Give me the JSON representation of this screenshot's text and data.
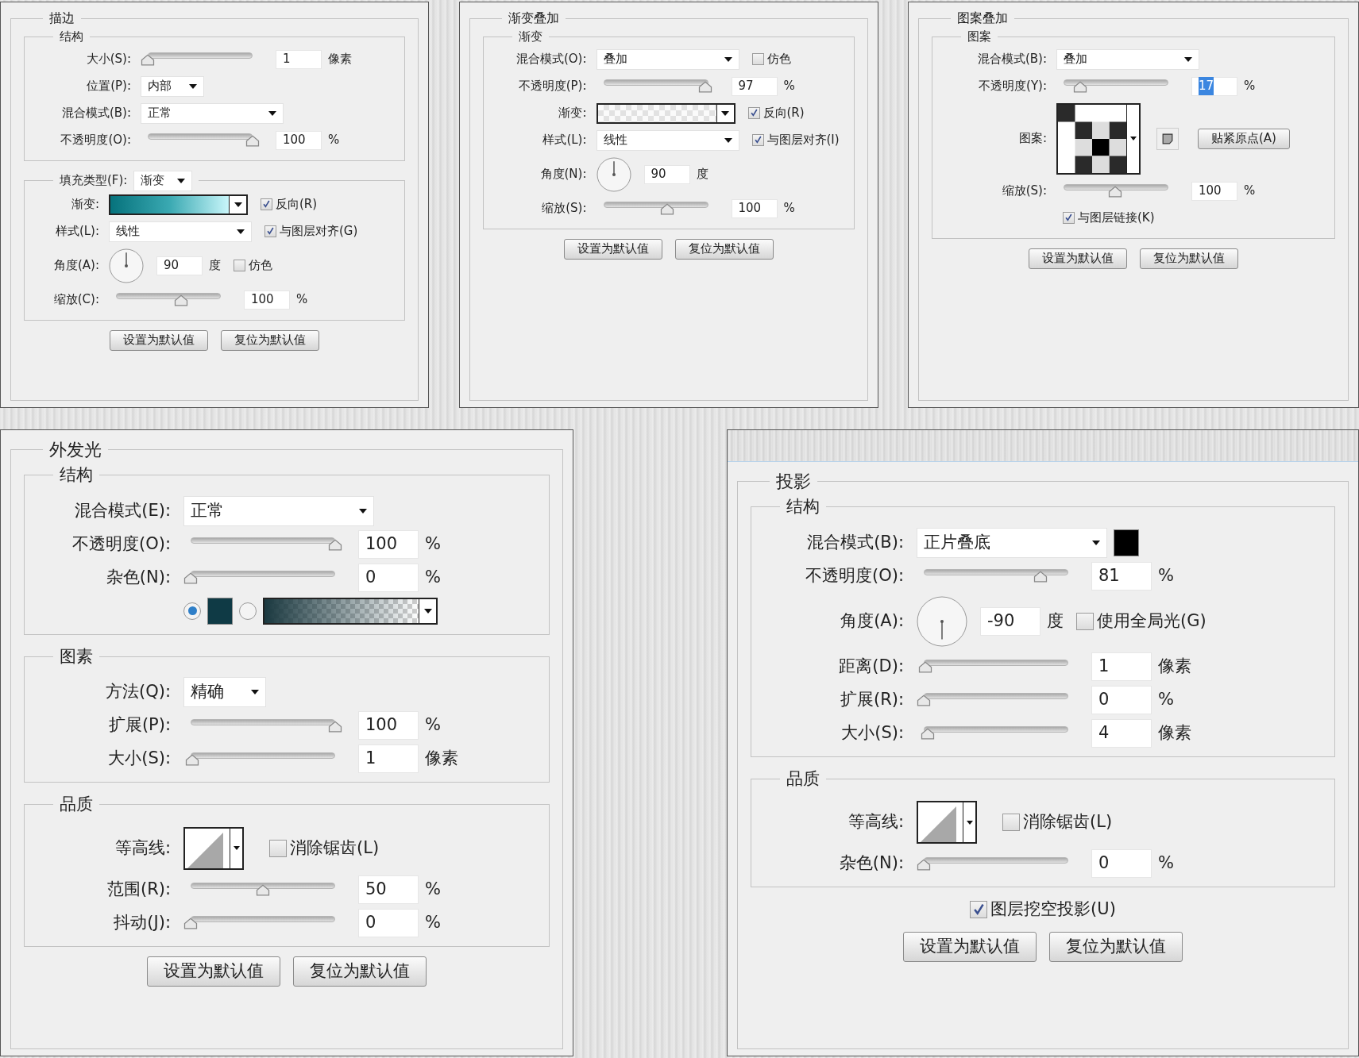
{
  "panels": [
    {
      "title": "描边",
      "groups": [
        {
          "legend": "结构",
          "rows": [
            {
              "label": "大小(S):",
              "items": [
                {
                  "kind": "slider",
                  "level": 0
                },
                {
                  "kind": "input",
                  "value": "1"
                },
                {
                  "kind": "unit",
                  "text": "像素"
                }
              ]
            },
            {
              "label": "位置(P):",
              "items": [
                {
                  "kind": "select",
                  "value": "内部"
                }
              ]
            },
            {
              "label": "混合模式(B):",
              "items": [
                {
                  "kind": "select",
                  "value": "正常"
                }
              ]
            },
            {
              "label": "不透明度(O):",
              "items": [
                {
                  "kind": "slider",
                  "level": 1
                },
                {
                  "kind": "input",
                  "value": "100"
                },
                {
                  "kind": "unit",
                  "text": "%"
                }
              ]
            }
          ]
        },
        {
          "legend": "填充类型(F):",
          "legend_select": "渐变",
          "rows": [
            {
              "label": "渐变:",
              "items": [
                {
                  "kind": "teal_gradient"
                },
                {
                  "kind": "checkbox",
                  "label": "反向(R)",
                  "checked": true
                }
              ]
            },
            {
              "label": "样式(L):",
              "items": [
                {
                  "kind": "select",
                  "value": "线性"
                },
                {
                  "kind": "checkbox",
                  "label": "与图层对齐(G)",
                  "checked": true
                }
              ]
            },
            {
              "label": "角度(A):",
              "items": [
                {
                  "kind": "dial",
                  "pointing_down": false
                },
                {
                  "kind": "input",
                  "value": "90"
                },
                {
                  "kind": "unit",
                  "text": "度"
                },
                {
                  "kind": "checkbox",
                  "label": "仿色",
                  "checked": false
                }
              ]
            },
            {
              "label": "缩放(C):",
              "items": [
                {
                  "kind": "slider",
                  "level": 0.62
                },
                {
                  "kind": "input",
                  "value": "100"
                },
                {
                  "kind": "unit",
                  "text": "%"
                }
              ]
            }
          ]
        }
      ],
      "buttons": [
        "设置为默认值",
        "复位为默认值"
      ]
    },
    {
      "title": "渐变叠加",
      "groups": [
        {
          "legend": "渐变",
          "rows": [
            {
              "label": "混合模式(O):",
              "items": [
                {
                  "kind": "select",
                  "value": "叠加"
                },
                {
                  "kind": "checkbox",
                  "label": "仿色",
                  "checked": false
                }
              ]
            },
            {
              "label": "不透明度(P):",
              "items": [
                {
                  "kind": "slider",
                  "level": 0.97
                },
                {
                  "kind": "input",
                  "value": "97"
                },
                {
                  "kind": "unit",
                  "text": "%"
                }
              ]
            },
            {
              "label": "渐变:",
              "items": [
                {
                  "kind": "checker_gradient"
                },
                {
                  "kind": "checkbox",
                  "label": "反向(R)",
                  "checked": true
                }
              ]
            },
            {
              "label": "样式(L):",
              "items": [
                {
                  "kind": "select",
                  "value": "线性"
                },
                {
                  "kind": "checkbox",
                  "label": "与图层对齐(I)",
                  "checked": true
                }
              ]
            },
            {
              "label": "角度(N):",
              "items": [
                {
                  "kind": "dial",
                  "pointing_down": false
                },
                {
                  "kind": "input",
                  "value": "90"
                },
                {
                  "kind": "unit",
                  "text": "度"
                }
              ]
            },
            {
              "label": "缩放(S):",
              "items": [
                {
                  "kind": "slider",
                  "level": 0.61
                },
                {
                  "kind": "input",
                  "value": "100"
                },
                {
                  "kind": "unit",
                  "text": "%"
                }
              ]
            }
          ]
        }
      ],
      "buttons": [
        "设置为默认值",
        "复位为默认值"
      ]
    },
    {
      "title": "图案叠加",
      "groups": [
        {
          "legend": "图案",
          "rows": [
            {
              "label": "混合模式(B):",
              "items": [
                {
                  "kind": "select",
                  "value": "叠加"
                }
              ]
            },
            {
              "label": "不透明度(Y):",
              "items": [
                {
                  "kind": "slider",
                  "level": 0.16
                },
                {
                  "kind": "input",
                  "value": "17",
                  "text_selected": true
                },
                {
                  "kind": "unit",
                  "text": "%"
                }
              ]
            },
            {
              "label": "图案:",
              "items": [
                {
                  "kind": "pattern"
                },
                {
                  "kind": "icon_button"
                },
                {
                  "kind": "button",
                  "label": "贴紧原点(A)"
                }
              ]
            },
            {
              "label": "缩放(S):",
              "items": [
                {
                  "kind": "slider",
                  "level": 0.49
                },
                {
                  "kind": "input",
                  "value": "100"
                },
                {
                  "kind": "unit",
                  "text": "%"
                }
              ]
            },
            {
              "items": [
                {
                  "kind": "checkbox",
                  "label": "与图层链接(K)",
                  "checked": true
                }
              ]
            }
          ]
        }
      ],
      "buttons": [
        "设置为默认值",
        "复位为默认值"
      ]
    },
    {
      "title": "外发光",
      "groups": [
        {
          "legend": "结构",
          "rows": [
            {
              "label": "混合模式(E):",
              "items": [
                {
                  "kind": "select",
                  "value": "正常"
                }
              ]
            },
            {
              "label": "不透明度(O):",
              "items": [
                {
                  "kind": "slider",
                  "level": 1
                },
                {
                  "kind": "input",
                  "value": "100"
                },
                {
                  "kind": "unit",
                  "text": "%"
                }
              ]
            },
            {
              "label": "杂色(N):",
              "items": [
                {
                  "kind": "slider",
                  "level": 0
                },
                {
                  "kind": "input",
                  "value": "0"
                },
                {
                  "kind": "unit",
                  "text": "%"
                }
              ]
            },
            {
              "items": [
                {
                  "kind": "radio",
                  "selected": true
                },
                {
                  "kind": "swatch",
                  "color": "#0f3a45"
                },
                {
                  "kind": "radio",
                  "selected": false
                },
                {
                  "kind": "fade_gradient"
                }
              ]
            }
          ]
        },
        {
          "legend": "图素",
          "rows": [
            {
              "label": "方法(Q):",
              "items": [
                {
                  "kind": "select",
                  "value": "精确"
                }
              ]
            },
            {
              "label": "扩展(P):",
              "items": [
                {
                  "kind": "slider",
                  "level": 1
                },
                {
                  "kind": "input",
                  "value": "100"
                },
                {
                  "kind": "unit",
                  "text": "%"
                }
              ]
            },
            {
              "label": "大小(S):",
              "items": [
                {
                  "kind": "slider",
                  "level": 0.01
                },
                {
                  "kind": "input",
                  "value": "1"
                },
                {
                  "kind": "unit",
                  "text": "像素"
                }
              ]
            }
          ]
        },
        {
          "legend": "品质",
          "rows": [
            {
              "label": "等高线:",
              "items": [
                {
                  "kind": "contour"
                },
                {
                  "kind": "checkbox",
                  "label": "消除锯齿(L)",
                  "checked": false
                }
              ]
            },
            {
              "label": "范围(R):",
              "items": [
                {
                  "kind": "slider",
                  "level": 0.5
                },
                {
                  "kind": "input",
                  "value": "50"
                },
                {
                  "kind": "unit",
                  "text": "%"
                }
              ]
            },
            {
              "label": "抖动(J):",
              "items": [
                {
                  "kind": "slider",
                  "level": 0
                },
                {
                  "kind": "input",
                  "value": "0"
                },
                {
                  "kind": "unit",
                  "text": "%"
                }
              ]
            }
          ]
        }
      ],
      "buttons": [
        "设置为默认值",
        "复位为默认值"
      ]
    },
    {
      "title": "投影",
      "groups": [
        {
          "legend": "结构",
          "rows": [
            {
              "label": "混合模式(B):",
              "items": [
                {
                  "kind": "select",
                  "value": "正片叠底"
                },
                {
                  "kind": "swatch",
                  "color": "#000000"
                }
              ]
            },
            {
              "label": "不透明度(O):",
              "items": [
                {
                  "kind": "slider",
                  "level": 0.81
                },
                {
                  "kind": "input",
                  "value": "81"
                },
                {
                  "kind": "unit",
                  "text": "%"
                }
              ]
            },
            {
              "label": "角度(A):",
              "items": [
                {
                  "kind": "dial",
                  "pointing_down": true
                },
                {
                  "kind": "input",
                  "value": "-90"
                },
                {
                  "kind": "unit",
                  "text": "度"
                },
                {
                  "kind": "checkbox",
                  "label": "使用全局光(G)",
                  "checked": false
                }
              ]
            },
            {
              "label": "距离(D):",
              "items": [
                {
                  "kind": "slider",
                  "level": 0.01
                },
                {
                  "kind": "input",
                  "value": "1"
                },
                {
                  "kind": "unit",
                  "text": "像素"
                }
              ]
            },
            {
              "label": "扩展(R):",
              "items": [
                {
                  "kind": "slider",
                  "level": 0
                },
                {
                  "kind": "input",
                  "value": "0"
                },
                {
                  "kind": "unit",
                  "text": "%"
                }
              ]
            },
            {
              "label": "大小(S):",
              "items": [
                {
                  "kind": "slider",
                  "level": 0.03
                },
                {
                  "kind": "input",
                  "value": "4"
                },
                {
                  "kind": "unit",
                  "text": "像素"
                }
              ]
            }
          ]
        },
        {
          "legend": "品质",
          "rows": [
            {
              "label": "等高线:",
              "items": [
                {
                  "kind": "contour"
                },
                {
                  "kind": "checkbox",
                  "label": "消除锯齿(L)",
                  "checked": false
                }
              ]
            },
            {
              "label": "杂色(N):",
              "items": [
                {
                  "kind": "slider",
                  "level": 0
                },
                {
                  "kind": "input",
                  "value": "0"
                },
                {
                  "kind": "unit",
                  "text": "%"
                }
              ]
            }
          ]
        }
      ],
      "footer_checkbox": {
        "label": "图层挖空投影(U)",
        "checked": true
      },
      "buttons": [
        "设置为默认值",
        "复位为默认值"
      ]
    }
  ]
}
